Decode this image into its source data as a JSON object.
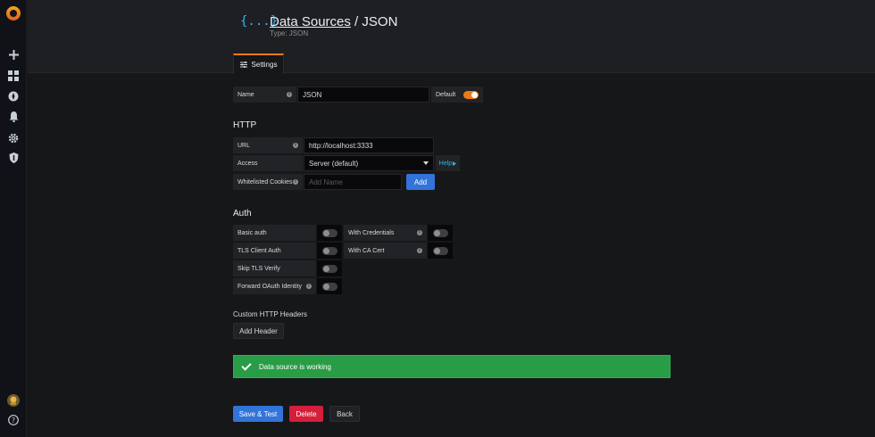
{
  "header": {
    "breadcrumb_link": "Data Sources",
    "separator": " / ",
    "title": "JSON",
    "subtitle": "Type: JSON",
    "icon_text": "{...}"
  },
  "tabs": [
    {
      "label": "Settings",
      "active": true
    }
  ],
  "general": {
    "name_label": "Name",
    "name_value": "JSON",
    "default_label": "Default",
    "default_on": true
  },
  "http": {
    "title": "HTTP",
    "url_label": "URL",
    "url_value": "http://localhost:3333",
    "access_label": "Access",
    "access_value": "Server (default)",
    "help_label": "Help",
    "cookies_label": "Whitelisted Cookies",
    "cookies_placeholder": "Add Name",
    "add_label": "Add"
  },
  "auth": {
    "title": "Auth",
    "basic_auth": "Basic auth",
    "with_credentials": "With Credentials",
    "tls_client_auth": "TLS Client Auth",
    "with_ca_cert": "With CA Cert",
    "skip_tls_verify": "Skip TLS Verify",
    "forward_oauth": "Forward OAuth Identity"
  },
  "headers": {
    "title": "Custom HTTP Headers",
    "add_header_label": "Add Header"
  },
  "alert": {
    "message": "Data source is working"
  },
  "actions": {
    "save_test": "Save & Test",
    "delete": "Delete",
    "back": "Back"
  },
  "colors": {
    "accent": "#eb7b18",
    "primary": "#3274d9",
    "danger": "#d41e3a",
    "success": "#299c46"
  },
  "icons": [
    "grafana-logo-icon",
    "plus-icon",
    "dashboards-icon",
    "explore-icon",
    "alerting-icon",
    "gear-icon",
    "shield-icon",
    "avatar",
    "help-icon"
  ]
}
